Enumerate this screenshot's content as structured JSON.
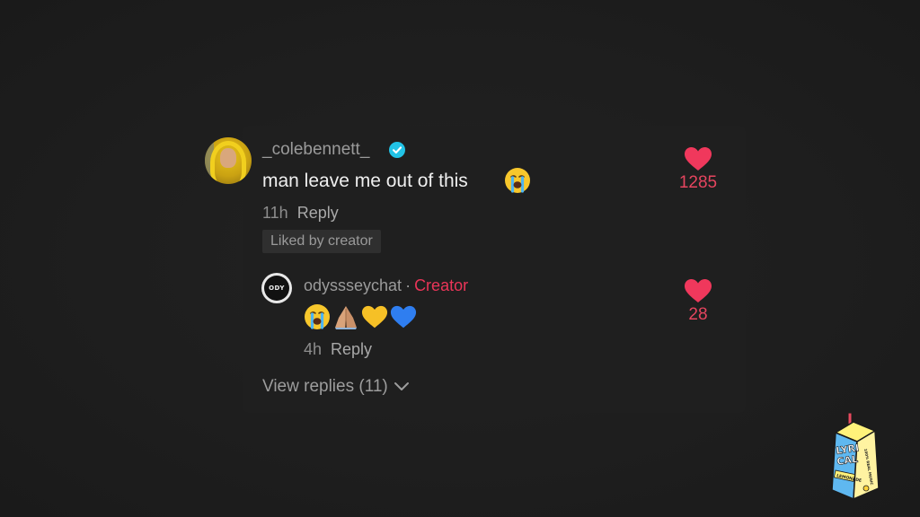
{
  "comment": {
    "username": "_colebennett_",
    "text": "man leave me out of this",
    "time": "11h",
    "reply_label": "Reply",
    "badge": "Liked by creator",
    "likes": "1285"
  },
  "reply": {
    "username": "odyssseychat",
    "separator": "·",
    "role": "Creator",
    "avatar_text": "ODY",
    "emojis": [
      "loudly-crying-face",
      "folded-hands",
      "yellow-heart",
      "blue-heart"
    ],
    "time": "4h",
    "reply_label": "Reply",
    "likes": "28"
  },
  "view_replies": {
    "label": "View replies (11)"
  },
  "watermark": {
    "brand": "LYRICAL LEMONADE",
    "line1": "LYRI",
    "line2": "CAL",
    "side_text": "100% REAL MUSIC",
    "bottom_text": "LEMONADE"
  },
  "colors": {
    "background": "#1e1e1e",
    "heart": "#f0385c",
    "creator": "#ea3558",
    "verified": "#22c3e6"
  }
}
